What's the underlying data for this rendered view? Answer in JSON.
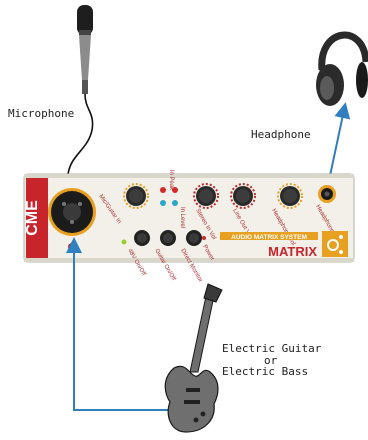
{
  "labels": {
    "microphone": "Microphone",
    "headphone": "Headphone",
    "guitar_line1": "Electric Guitar",
    "guitar_line2": "or",
    "guitar_line3": "Electric Bass"
  },
  "device": {
    "logo": "CME",
    "name": "MATRIX",
    "subtitle": "AUDIO MATRIX SYSTEM",
    "input_label": "Mic/Guitar In",
    "knobs": [
      {
        "label": "Mic/Guitar Gain"
      },
      {
        "label": "Stereo In Vol"
      },
      {
        "label": "Line Out Vol"
      },
      {
        "label": "Headphone Vol"
      }
    ],
    "leds": [
      {
        "label": "In Peak"
      },
      {
        "label": "In Level"
      }
    ],
    "buttons": [
      {
        "label": "48V On/Off"
      },
      {
        "label": "Guitar On/Off"
      },
      {
        "label": "Direct Monitor"
      }
    ],
    "power_label": "Power",
    "headphone_jack_label": "Headphone"
  },
  "colors": {
    "cable": "#2f7fc1",
    "device_body": "#f2f0e8",
    "logo_red": "#c8242b",
    "accent_orange": "#e8a020",
    "knob_red": "#c0282a"
  }
}
